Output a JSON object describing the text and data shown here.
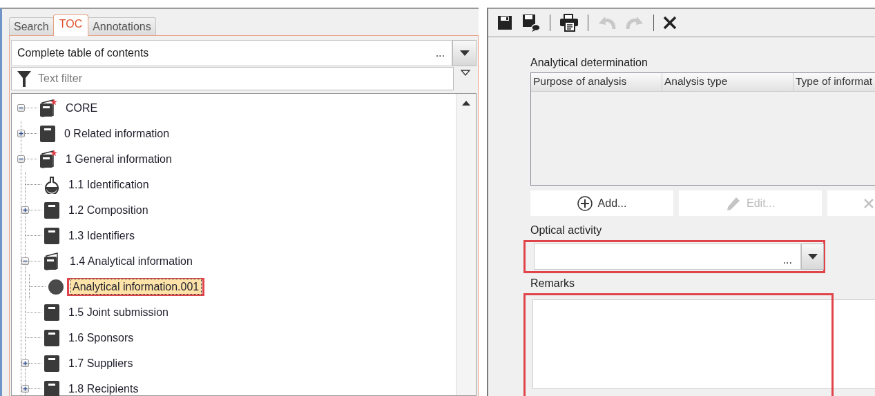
{
  "left_panel": {
    "tabs": [
      {
        "label": "Search",
        "selected": false
      },
      {
        "label": "TOC",
        "selected": true
      },
      {
        "label": "Annotations",
        "selected": false
      }
    ],
    "view_select": {
      "value": "Complete table of contents",
      "ellipsis": "..."
    },
    "filter": {
      "placeholder": "Text filter"
    },
    "tree": [
      {
        "label": "CORE",
        "kind": "binder-star",
        "expandable": true,
        "expanded": true,
        "selected": false,
        "children": [
          {
            "label": "0 Related information",
            "kind": "book",
            "expandable": true,
            "expanded": false,
            "selected": false
          },
          {
            "label": "1 General information",
            "kind": "binder-star",
            "expandable": true,
            "expanded": true,
            "selected": false,
            "children": [
              {
                "label": "1.1 Identification",
                "kind": "flask",
                "expandable": false,
                "selected": false
              },
              {
                "label": "1.2 Composition",
                "kind": "book",
                "expandable": true,
                "expanded": false,
                "selected": false
              },
              {
                "label": "1.3 Identifiers",
                "kind": "book",
                "expandable": false,
                "selected": false
              },
              {
                "label": "1.4 Analytical information",
                "kind": "binder",
                "expandable": true,
                "expanded": true,
                "selected": false,
                "children": [
                  {
                    "label": "Analytical information.001",
                    "kind": "circle",
                    "expandable": false,
                    "selected": true,
                    "highlighted": true
                  }
                ]
              },
              {
                "label": "1.5 Joint submission",
                "kind": "book",
                "expandable": false,
                "selected": false
              },
              {
                "label": "1.6 Sponsors",
                "kind": "book",
                "expandable": false,
                "selected": false
              },
              {
                "label": "1.7 Suppliers",
                "kind": "book",
                "expandable": true,
                "expanded": false,
                "selected": false
              },
              {
                "label": "1.8 Recipients",
                "kind": "book",
                "expandable": true,
                "expanded": false,
                "selected": false
              }
            ]
          }
        ]
      }
    ]
  },
  "right_panel": {
    "toolbar": [
      {
        "kind": "save",
        "disabled": false
      },
      {
        "kind": "save-comment",
        "disabled": false
      },
      {
        "kind": "separator"
      },
      {
        "kind": "print",
        "disabled": false
      },
      {
        "kind": "separator"
      },
      {
        "kind": "undo",
        "disabled": true
      },
      {
        "kind": "redo",
        "disabled": true
      },
      {
        "kind": "separator"
      },
      {
        "kind": "close",
        "disabled": false
      }
    ],
    "table": {
      "label": "Analytical determination",
      "columns": [
        "Purpose of analysis",
        "Analysis type",
        "Type of informat"
      ]
    },
    "buttons": [
      {
        "label": "Add...",
        "kind": "plus",
        "disabled": false
      },
      {
        "label": "Edit...",
        "kind": "pencil",
        "disabled": true
      },
      {
        "kind": "cross",
        "disabled": true
      }
    ],
    "optical_activity": {
      "label": "Optical activity",
      "ellipsis": "...",
      "highlighted": true
    },
    "remarks": {
      "label": "Remarks",
      "highlighted": true
    }
  }
}
